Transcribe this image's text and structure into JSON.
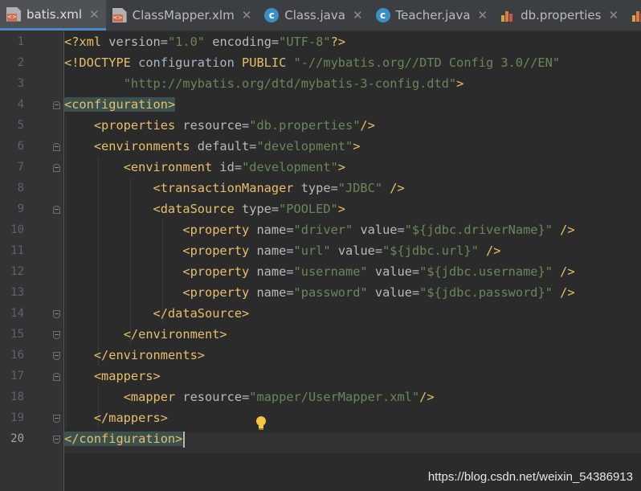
{
  "tabs": [
    {
      "label": "batis.xml",
      "icon": "xml-file-icon",
      "active": true,
      "closable": true
    },
    {
      "label": "ClassMapper.xlm",
      "icon": "xml-file-icon",
      "active": false,
      "closable": true
    },
    {
      "label": "Class.java",
      "icon": "java-class-icon",
      "active": false,
      "closable": true
    },
    {
      "label": "Teacher.java",
      "icon": "java-class-icon",
      "active": false,
      "closable": true
    },
    {
      "label": "db.properties",
      "icon": "properties-file-icon",
      "active": false,
      "closable": true
    }
  ],
  "editor": {
    "current_line": 20,
    "line_numbers": [
      "1",
      "2",
      "3",
      "4",
      "5",
      "6",
      "7",
      "8",
      "9",
      "10",
      "11",
      "12",
      "13",
      "14",
      "15",
      "16",
      "17",
      "18",
      "19",
      "20"
    ],
    "code": {
      "l1": {
        "a": "<?xml ",
        "b": "version",
        "c": "=",
        "d": "\"1.0\"",
        "e": " ",
        "f": "encoding",
        "g": "=",
        "h": "\"UTF-8\"",
        "i": "?>"
      },
      "l2": {
        "a": "<!DOCTYPE ",
        "b": "configuration ",
        "c": "PUBLIC ",
        "d": "\"-//mybatis.org//DTD Config 3.0//EN\""
      },
      "l3": {
        "a": "        ",
        "b": "\"http://mybatis.org/dtd/mybatis-3-config.dtd\"",
        "c": ">"
      },
      "l4": {
        "a": "<configuration>"
      },
      "l5": {
        "a": "    ",
        "b": "<properties ",
        "c": "resource",
        "d": "=",
        "e": "\"db.properties\"",
        "f": "/>"
      },
      "l6": {
        "a": "    ",
        "b": "<environments ",
        "c": "default",
        "d": "=",
        "e": "\"development\"",
        "f": ">"
      },
      "l7": {
        "a": "        ",
        "b": "<environment ",
        "c": "id",
        "d": "=",
        "e": "\"development\"",
        "f": ">"
      },
      "l8": {
        "a": "            ",
        "b": "<transactionManager ",
        "c": "type",
        "d": "=",
        "e": "\"JDBC\"",
        "f": " />"
      },
      "l9": {
        "a": "            ",
        "b": "<dataSource ",
        "c": "type",
        "d": "=",
        "e": "\"POOLED\"",
        "f": ">"
      },
      "l10": {
        "a": "                ",
        "b": "<property ",
        "c": "name",
        "d": "=",
        "e": "\"driver\"",
        "f": " ",
        "g": "value",
        "h": "=",
        "i": "\"${jdbc.driverName}\"",
        "j": " />"
      },
      "l11": {
        "a": "                ",
        "b": "<property ",
        "c": "name",
        "d": "=",
        "e": "\"url\"",
        "f": " ",
        "g": "value",
        "h": "=",
        "i": "\"${jdbc.url}\"",
        "j": " />"
      },
      "l12": {
        "a": "                ",
        "b": "<property ",
        "c": "name",
        "d": "=",
        "e": "\"username\"",
        "f": " ",
        "g": "value",
        "h": "=",
        "i": "\"${jdbc.username}\"",
        "j": " />"
      },
      "l13": {
        "a": "                ",
        "b": "<property ",
        "c": "name",
        "d": "=",
        "e": "\"password\"",
        "f": " ",
        "g": "value",
        "h": "=",
        "i": "\"${jdbc.password}\"",
        "j": " />"
      },
      "l14": {
        "a": "            ",
        "b": "</dataSource>"
      },
      "l15": {
        "a": "        ",
        "b": "</environment>"
      },
      "l16": {
        "a": "    ",
        "b": "</environments>"
      },
      "l17": {
        "a": "    ",
        "b": "<mappers>"
      },
      "l18": {
        "a": "        ",
        "b": "<mapper ",
        "c": "resource",
        "d": "=",
        "e": "\"mapper/UserMapper.xml\"",
        "f": "/>"
      },
      "l19": {
        "a": "    ",
        "b": "</mappers>"
      },
      "l20": {
        "a": "</configuration>"
      }
    }
  },
  "watermark": "https://blog.csdn.net/weixin_54386913",
  "colors": {
    "background": "#2b2b2b",
    "tag": "#e8bf6a",
    "attribute": "#bababa",
    "value": "#6a8759",
    "text": "#a9b7c6",
    "active_tab_underline": "#4a88c7"
  }
}
